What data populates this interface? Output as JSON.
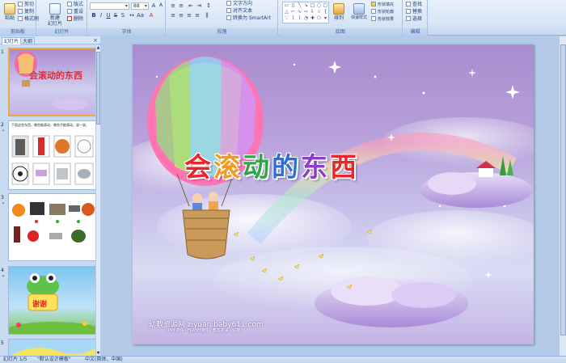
{
  "ribbon": {
    "clipboard": {
      "label": "剪贴板",
      "paste": "粘贴",
      "cut": "剪切",
      "copy": "复制",
      "format_painter": "格式刷"
    },
    "slides": {
      "label": "幻灯片",
      "new_slide": "新建\n幻灯片",
      "layout": "版式",
      "reset": "重设",
      "delete": "删除"
    },
    "font": {
      "label": "字体",
      "font_size": "88"
    },
    "paragraph": {
      "label": "段落",
      "text_direction": "文字方向",
      "align_text": "对齐文本",
      "convert_smartart": "转换为 SmartArt"
    },
    "drawing": {
      "label": "绘图",
      "arrange": "排列",
      "quick_styles": "快速样式",
      "shape_fill": "形状填充",
      "shape_outline": "形状轮廓",
      "shape_effects": "形状效果"
    },
    "editing": {
      "label": "编辑",
      "find": "查找",
      "replace": "替换",
      "select": "选择"
    }
  },
  "left_pane": {
    "tabs": [
      "幻灯片",
      "大纲"
    ],
    "close": "×",
    "slide_numbers": [
      "1",
      "2",
      "3",
      "4",
      "5"
    ],
    "thumb2_caption": "下面这些东西，哪些能滚动，哪些不能滚动，说一说。",
    "thumb4_text": "谢谢"
  },
  "slide": {
    "title_chars": [
      "会",
      "滚",
      "动",
      "的",
      "东",
      "西"
    ],
    "title_colors": [
      "#e8262b",
      "#f29a1d",
      "#30a546",
      "#2a6fd6",
      "#8c3fc4",
      "#e8262b"
    ],
    "watermark": "幼教资源网 ziyuan.baby611.com",
    "watermark_sub": "PPT课件 · FLASH课件 · 教案故事 · 试卷"
  },
  "status": {
    "slide_info": "幻灯片 1/5",
    "theme": "\"默认设计模板\"",
    "language": "中文(简体，中国)"
  }
}
